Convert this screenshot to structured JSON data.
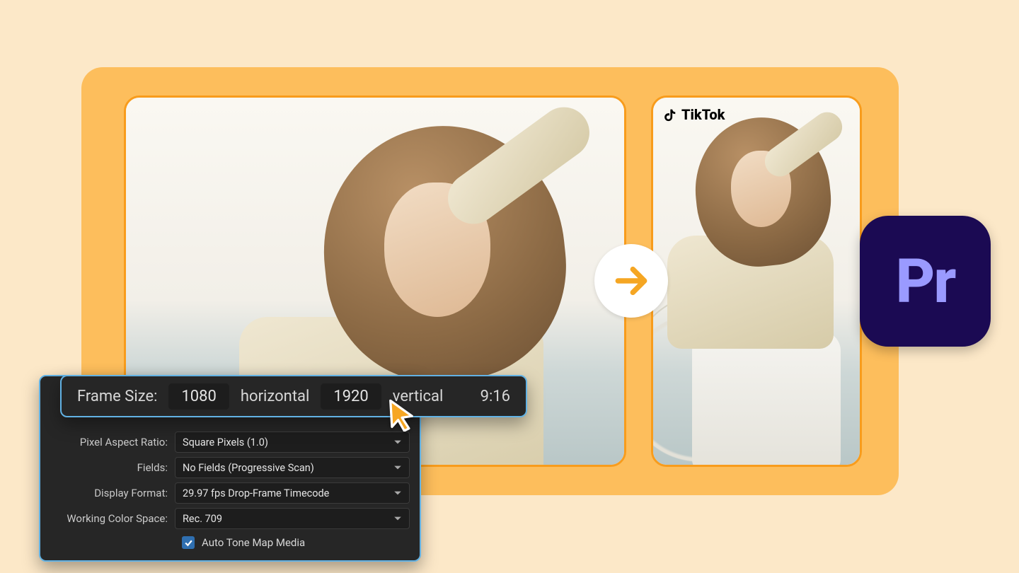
{
  "tiktok_label": "TikTok",
  "premiere_abbrev": "Pr",
  "frame": {
    "label": "Frame Size:",
    "width": "1080",
    "h_label": "horizontal",
    "height": "1920",
    "v_label": "vertical",
    "ratio": "9:16"
  },
  "settings": {
    "pixel_aspect": {
      "label": "Pixel Aspect Ratio:",
      "value": "Square Pixels (1.0)"
    },
    "fields": {
      "label": "Fields:",
      "value": "No Fields (Progressive Scan)"
    },
    "display": {
      "label": "Display Format:",
      "value": "29.97 fps Drop-Frame Timecode"
    },
    "color_space": {
      "label": "Working Color Space:",
      "value": "Rec. 709"
    },
    "auto_tone": {
      "label": "Auto Tone Map Media",
      "checked": true
    }
  }
}
